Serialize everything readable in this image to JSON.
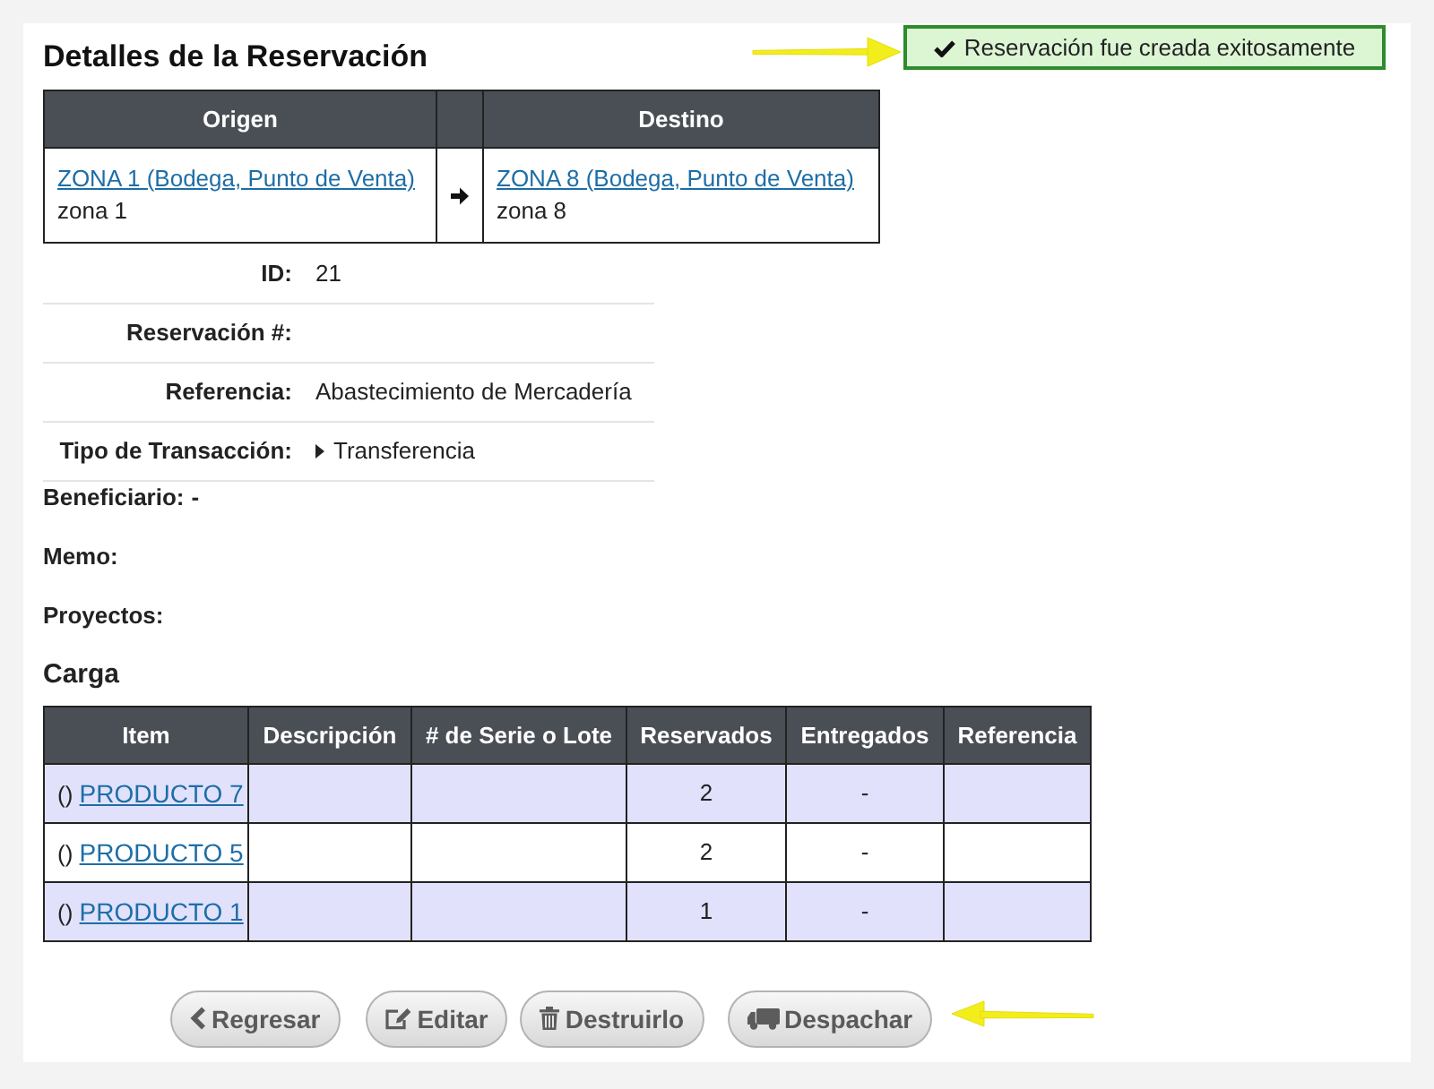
{
  "notice": {
    "text": "Reservación fue creada exitosamente"
  },
  "title": "Detalles de la Reservación",
  "route": {
    "origin_heading": "Origen",
    "destination_heading": "Destino",
    "origin": {
      "link": "ZONA 1 (Bodega, Punto de Venta)",
      "name": "zona 1"
    },
    "destination": {
      "link": "ZONA 8 (Bodega, Punto de Venta)",
      "name": "zona 8"
    }
  },
  "details": [
    {
      "label": "ID:",
      "value": "21",
      "kind": "plain"
    },
    {
      "label": "Reservación #:",
      "kind": "plain"
    },
    {
      "label": "Referencia:",
      "value": "Abastecimiento de Mercadería",
      "kind": "plain"
    },
    {
      "label": "Tipo de Transacción:",
      "value": "Transferencia",
      "kind": "disclosure"
    }
  ],
  "summary": [
    {
      "label": "Beneficiario:",
      "value": "-"
    },
    {
      "label": "Memo:"
    },
    {
      "label": "Proyectos:"
    }
  ],
  "cargo": {
    "title": "Carga",
    "columns": [
      "Item",
      "Descripción",
      "# de Serie o Lote",
      "Reservados",
      "Entregados",
      "Referencia"
    ],
    "rows": [
      {
        "code": "()",
        "item": "PRODUCTO 7",
        "reserved": "2",
        "delivered": "-"
      },
      {
        "code": "()",
        "item": "PRODUCTO 5",
        "reserved": "2",
        "delivered": "-"
      },
      {
        "code": "()",
        "item": "PRODUCTO 1",
        "reserved": "1",
        "delivered": "-"
      }
    ]
  },
  "buttons": [
    {
      "label": "Regresar",
      "kind": "back"
    },
    {
      "label": "Editar",
      "kind": "edit"
    },
    {
      "label": "Destruirlo",
      "kind": "delete"
    },
    {
      "label": "Despachar",
      "kind": "dispatch"
    }
  ]
}
